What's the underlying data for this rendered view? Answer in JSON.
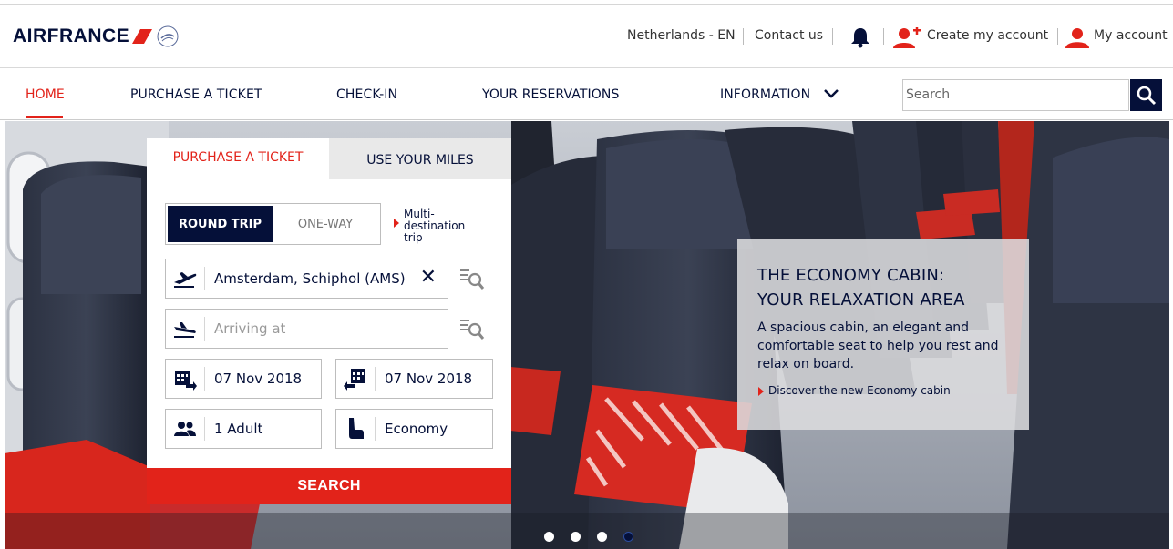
{
  "brand": {
    "name": "AIRFRANCE",
    "red": "#e2231a",
    "navy": "#051039"
  },
  "utility": {
    "locale": "Netherlands - EN",
    "contact": "Contact us",
    "notifications_icon": "bell-icon",
    "create_account": "Create my account",
    "my_account": "My account"
  },
  "nav": {
    "items": [
      {
        "label": "HOME",
        "active": true
      },
      {
        "label": "PURCHASE A TICKET"
      },
      {
        "label": "CHECK-IN"
      },
      {
        "label": "YOUR RESERVATIONS"
      },
      {
        "label": "INFORMATION"
      }
    ],
    "search_placeholder": "Search"
  },
  "booking": {
    "tabs": [
      "PURCHASE A TICKET",
      "USE YOUR MILES"
    ],
    "trip_types": [
      "ROUND TRIP",
      "ONE-WAY"
    ],
    "multi_destination": [
      "Multi-",
      "destination",
      "trip"
    ],
    "departure": "Amsterdam, Schiphol (AMS)",
    "arrival_placeholder": "Arriving at",
    "date_out": "07 Nov 2018",
    "date_return": "07 Nov 2018",
    "passengers": "1 Adult",
    "cabin": "Economy",
    "search_label": "SEARCH"
  },
  "promo": {
    "title_line1": "THE ECONOMY CABIN:",
    "title_line2": "YOUR RELAXATION AREA",
    "text": "A spacious cabin, an elegant and comfortable seat to help you rest and relax on board.",
    "link": "Discover the new Economy cabin"
  },
  "carousel": {
    "slides": 4,
    "active": 4
  }
}
